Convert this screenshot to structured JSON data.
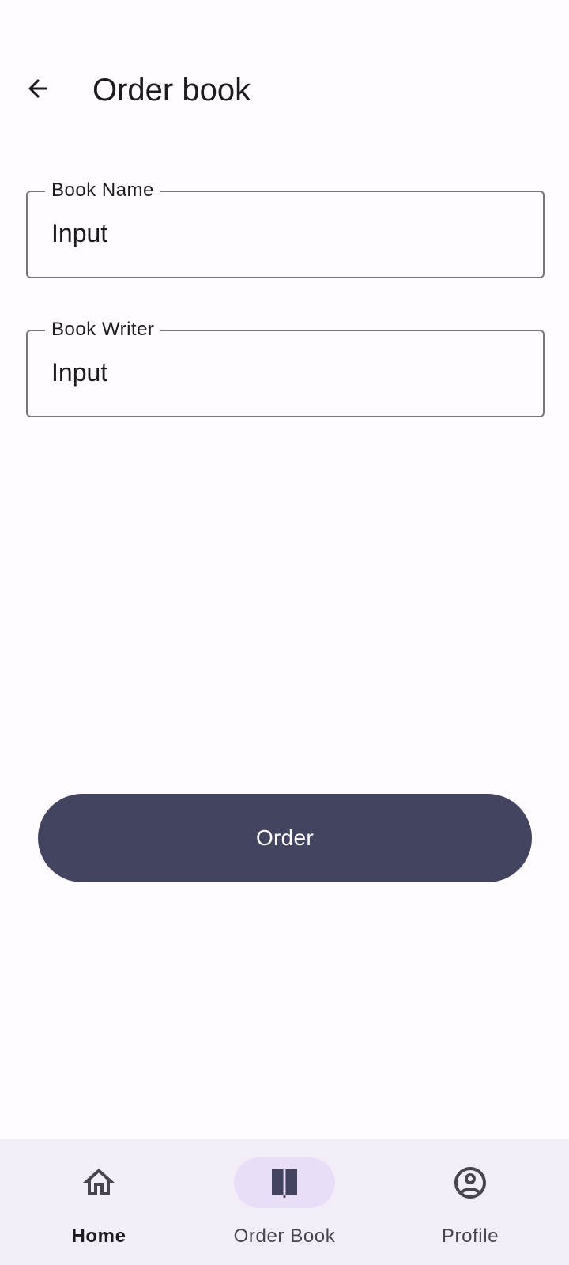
{
  "header": {
    "title": "Order book",
    "back_icon": "arrow-back-icon"
  },
  "form": {
    "book_name": {
      "label": "Book Name",
      "value": "",
      "placeholder": "Input"
    },
    "book_writer": {
      "label": "Book Writer",
      "value": "",
      "placeholder": "Input"
    }
  },
  "actions": {
    "order_label": "Order"
  },
  "bottom_nav": {
    "items": [
      {
        "label": "Home",
        "icon": "home-icon",
        "selected": false
      },
      {
        "label": "Order Book",
        "icon": "book-icon",
        "selected": true
      },
      {
        "label": "Profile",
        "icon": "account-circle-icon",
        "selected": false
      }
    ]
  },
  "colors": {
    "background": "#fffbfe",
    "primary_button": "#434560",
    "nav_background": "#f3edf7",
    "nav_indicator": "#e8def8",
    "outline": "#79747e"
  }
}
